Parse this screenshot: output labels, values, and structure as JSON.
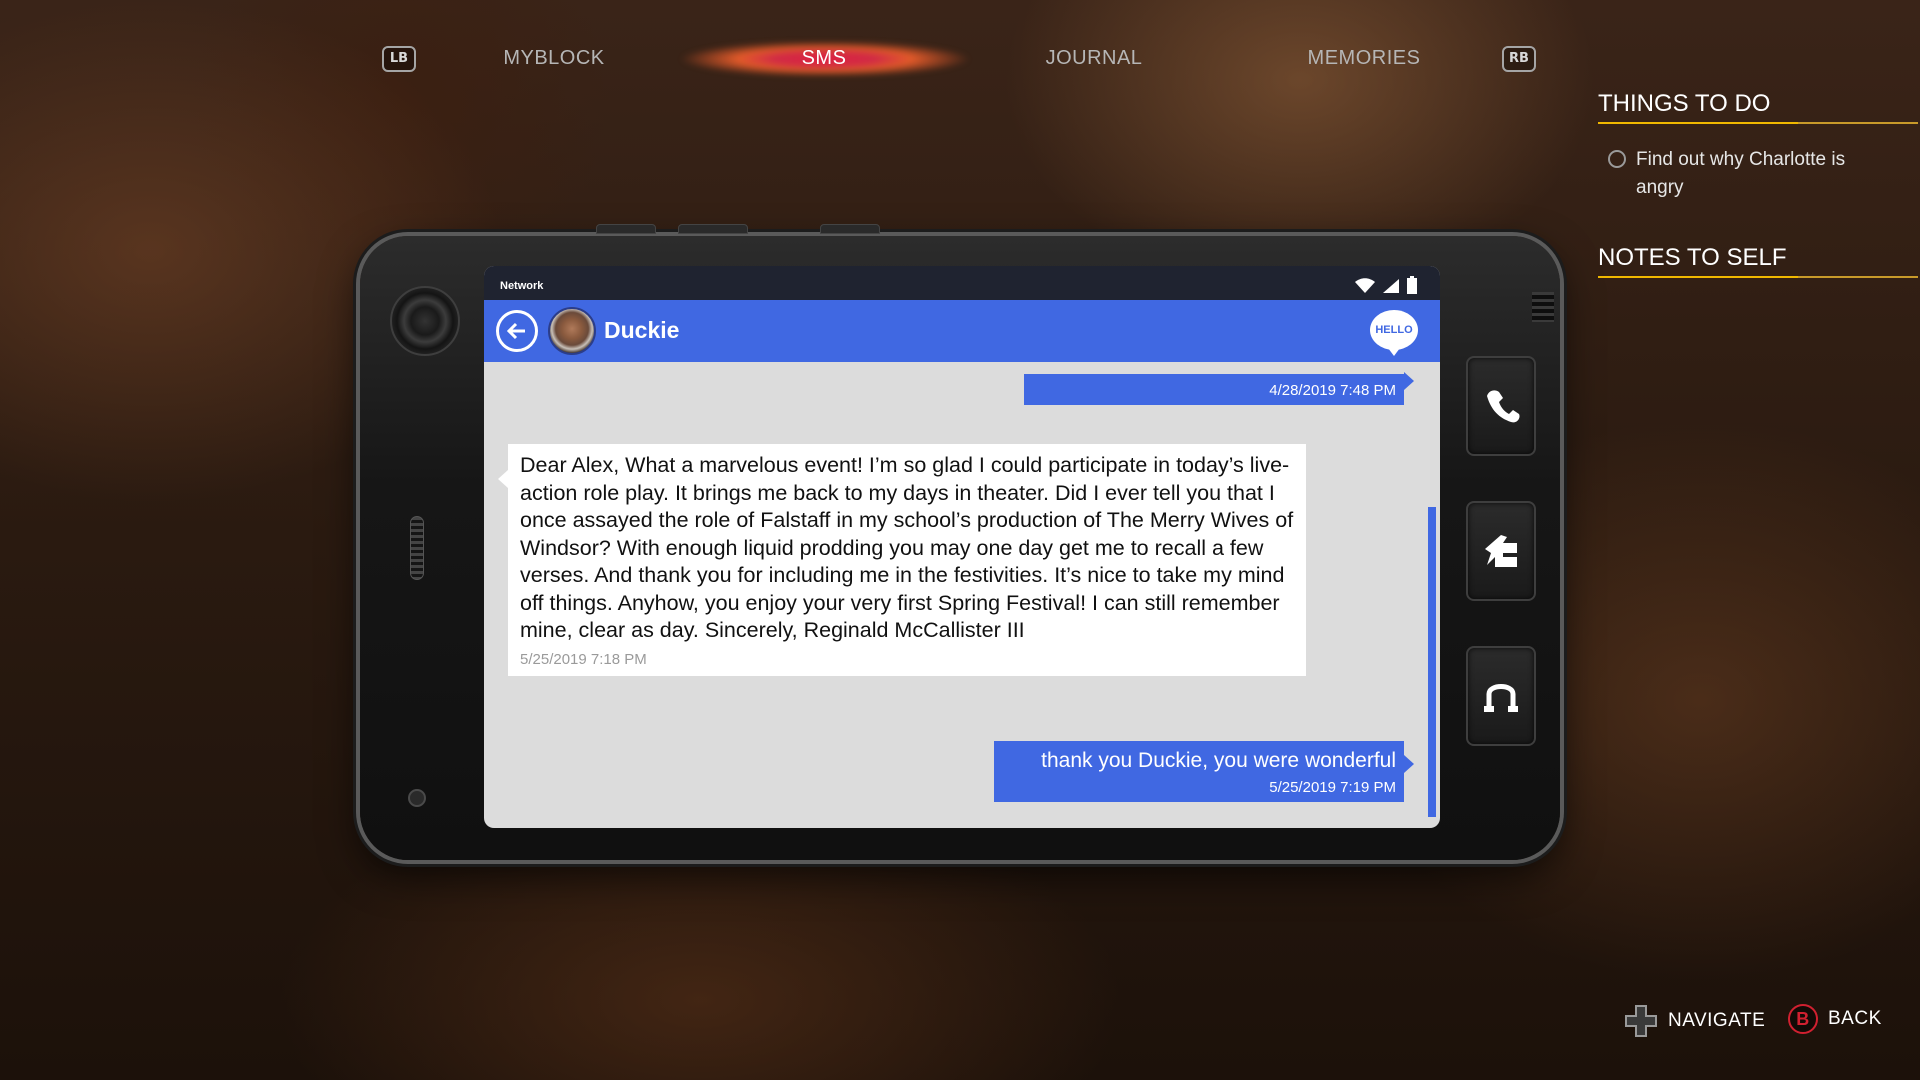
{
  "tabs": {
    "lb": "LB",
    "rb": "RB",
    "items": [
      {
        "label": "MYBLOCK"
      },
      {
        "label": "SMS"
      },
      {
        "label": "JOURNAL"
      },
      {
        "label": "MEMORIES"
      }
    ],
    "active": "SMS"
  },
  "things_to_do": {
    "title": "THINGS TO DO",
    "items": [
      {
        "text": "Find out why Charlotte is angry",
        "done": false
      }
    ]
  },
  "notes_to_self": {
    "title": "NOTES TO SELF"
  },
  "phone": {
    "status": {
      "network": "Network"
    },
    "contact": {
      "name": "Duckie"
    },
    "hello_badge": "HELLO",
    "messages": [
      {
        "direction": "outgoing",
        "text": "",
        "time": "4/28/2019 7:48 PM"
      },
      {
        "direction": "incoming",
        "text": "Dear Alex, What a marvelous event! I’m so glad I could participate in today’s live-action role play. It brings me back to my days in theater. Did I ever tell you that I once assayed the role of Falstaff in my school’s production of The Merry Wives of Windsor? With enough liquid prodding you may one day get me to recall a few verses. And thank you for including me in the festivities. It’s nice to take my mind off things. Anyhow, you enjoy your very first Spring Festival! I can still remember mine, clear as day. Sincerely, Reginald McCallister III",
        "time": "5/25/2019 7:18 PM"
      },
      {
        "direction": "outgoing",
        "text": "thank you Duckie, you were wonderful",
        "time": "5/25/2019 7:19 PM"
      }
    ],
    "side_buttons": [
      "phone-icon",
      "hand-point-icon",
      "hanger-icon"
    ]
  },
  "hints": {
    "navigate": "NAVIGATE",
    "back_key": "B",
    "back": "BACK"
  },
  "colors": {
    "accent_blue": "#4068e2",
    "active_tab_glow": "#e0203e",
    "section_underline": "#f0b800"
  }
}
